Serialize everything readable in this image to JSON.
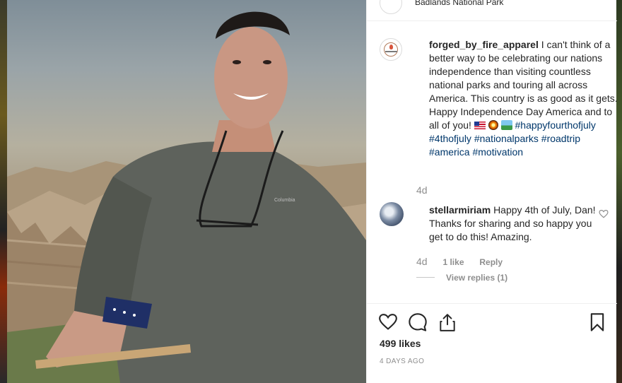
{
  "header": {
    "location": "Badlands National Park"
  },
  "post": {
    "username": "forged_by_fire_apparel",
    "caption_part1": "I can't think of a better way to be celebrating our nations independence than visiting countless national parks and touring all across America. This country is as good as it gets. Happy Independence Day America and to all of you!",
    "hashtags": [
      "#happyfourthofjuly",
      "#4thofjuly",
      "#nationalparks",
      "#roadtrip",
      "#america",
      "#motivation"
    ],
    "time": "4d",
    "likes": "499 likes",
    "ago": "4 DAYS AGO"
  },
  "comment": {
    "username": "stellarmiriam",
    "text": "Happy 4th of July, Dan! Thanks for sharing and so happy you get to do this! Amazing.",
    "time": "4d",
    "likes": "1 like",
    "reply_label": "Reply",
    "view_replies": "View replies (1)"
  },
  "icons": {
    "like": "heart-icon",
    "comment": "comment-icon",
    "share": "share-icon",
    "save": "bookmark-icon",
    "comment_like": "heart-icon"
  },
  "colors": {
    "text": "#262626",
    "muted": "#8e8e8e",
    "hashtag": "#00376b",
    "border": "#efefef"
  }
}
